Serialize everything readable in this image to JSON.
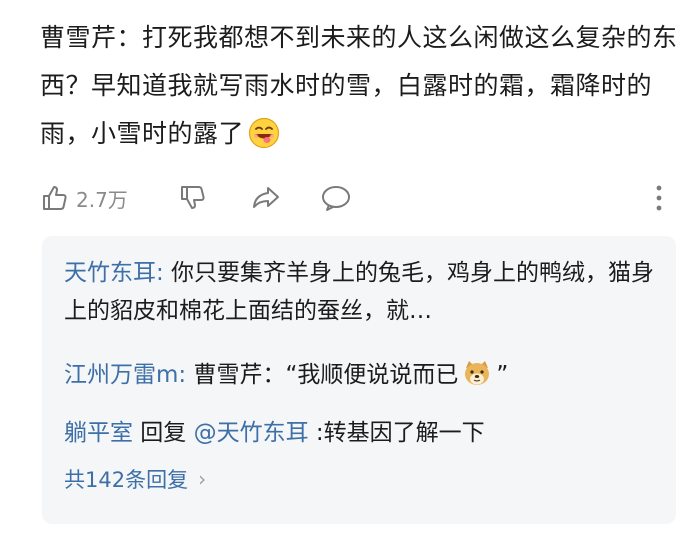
{
  "comment": {
    "author": "曹雪芹",
    "sep": "：",
    "text": "打死我都想不到未来的人这么闲做这么复杂的东西？早知道我就写雨水时的雪，白露时的霜，霜降时的雨，小雪时的露了",
    "emoji": "grinning-tongue-emoji"
  },
  "actions": {
    "like_count": "2.7万",
    "icons": [
      "thumbs-up-icon",
      "thumbs-down-icon",
      "share-icon",
      "comment-icon",
      "more-vertical-icon"
    ]
  },
  "replies": [
    {
      "author": "天竹东耳",
      "sep": ":",
      "text": " 你只要集齐羊身上的兔毛，鸡身上的鸭绒，猫身上的貂皮和棉花上面结的蚕丝，就…"
    },
    {
      "author": "江州万雷m",
      "sep": ":",
      "text_before": " 曹雪芹：“我顺便说说而已",
      "emoji": "doge-emoji",
      "text_after": "”"
    },
    {
      "author": "躺平室",
      "reply_word": " 回复 ",
      "mention": "@天竹东耳",
      "text": " :转基因了解一下"
    }
  ],
  "more_replies": "共142条回复",
  "colors": {
    "link": "#3d6fa8",
    "text": "#1c1c1c",
    "muted": "#8a8a8a",
    "box_bg": "#f5f6f7"
  }
}
